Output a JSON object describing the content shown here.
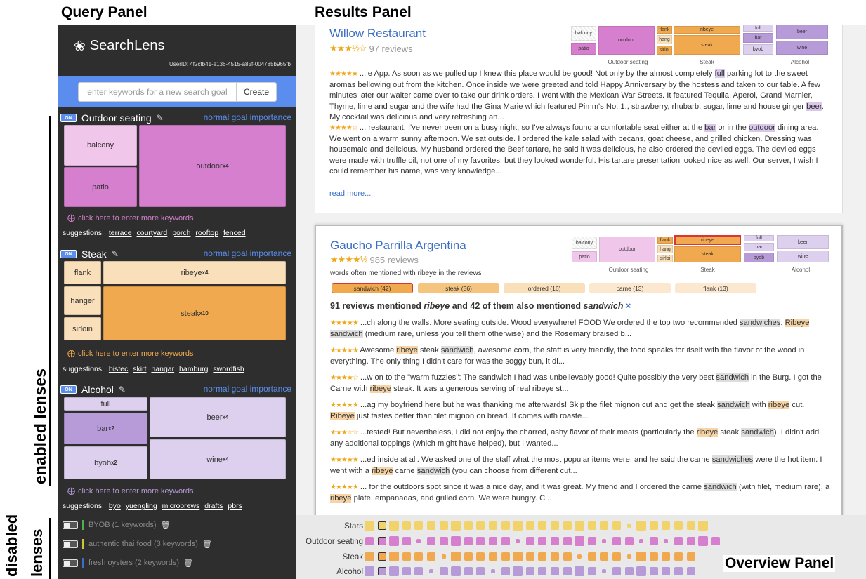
{
  "headings": {
    "query_panel": "Query Panel",
    "results_panel": "Results Panel",
    "overview_panel": "Overview Panel"
  },
  "side_labels": {
    "enabled": "enabled lenses",
    "disabled_line1": "disabled",
    "disabled_line2": "lenses"
  },
  "app": {
    "name": "SearchLens",
    "user_id": "UserID: 4f2cfb41-e136-4515-a85f-004785b965fb"
  },
  "goal": {
    "placeholder": "enter keywords for a new search goal",
    "create_label": "Create"
  },
  "colors": {
    "accent": "#5a8dee",
    "outdoor": "#d77fcf",
    "outdoor_light": "#f0c7ea",
    "steak": "#f0a94f",
    "steak_light": "#f9dfba",
    "alcohol": "#b79bd8",
    "alcohol_light": "#ddd0ee",
    "query_bg": "#2e2e2e"
  },
  "lenses": [
    {
      "toggle": "ON",
      "title": "Outdoor seating",
      "importance": "normal goal importance",
      "cells": [
        {
          "label": "balcony",
          "mult": ""
        },
        {
          "label": "patio",
          "mult": ""
        },
        {
          "label": "outdoor",
          "mult": "x4"
        }
      ],
      "more": "click here to enter more keywords",
      "suggestions_label": "suggestions:",
      "suggestions": [
        "terrace",
        "courtyard",
        "porch",
        "rooftop",
        "fenced"
      ]
    },
    {
      "toggle": "ON",
      "title": "Steak",
      "importance": "normal goal importance",
      "cells": [
        {
          "label": "flank",
          "mult": ""
        },
        {
          "label": "ribeye",
          "mult": "x4"
        },
        {
          "label": "hanger",
          "mult": ""
        },
        {
          "label": "sirloin",
          "mult": ""
        },
        {
          "label": "steak",
          "mult": "x10"
        }
      ],
      "more": "click here to enter more keywords",
      "suggestions_label": "suggestions:",
      "suggestions": [
        "bistec",
        "skirt",
        "hangar",
        "hamburg",
        "swordfish"
      ]
    },
    {
      "toggle": "ON",
      "title": "Alcohol",
      "importance": "normal goal importance",
      "cells": [
        {
          "label": "full",
          "mult": ""
        },
        {
          "label": "bar",
          "mult": "x2"
        },
        {
          "label": "byob",
          "mult": "x2"
        },
        {
          "label": "beer",
          "mult": "x4"
        },
        {
          "label": "wine",
          "mult": "x4"
        }
      ],
      "more": "click here to enter more keywords",
      "suggestions_label": "suggestions:",
      "suggestions": [
        "byo",
        "yuengling",
        "microbrews",
        "drafts",
        "pbrs"
      ]
    }
  ],
  "disabled_lenses": [
    {
      "label": "BYOB (1 keywords)",
      "color": "#4caf50"
    },
    {
      "label": "authentic thai food (3 keywords)",
      "color": "#c8c83c"
    },
    {
      "label": "fresh oysters (2 keywords)",
      "color": "#3a6fc4"
    }
  ],
  "mini_treemap": {
    "outdoor": [
      "balcony",
      "outdoor",
      "patio"
    ],
    "steak": [
      "flank",
      "ribeye",
      "hang",
      "sirloi",
      "steak"
    ],
    "alcohol": [
      "full",
      "beer",
      "bar",
      "byob",
      "wine"
    ],
    "labels": [
      "Outdoor seating",
      "Steak",
      "Alcohol"
    ]
  },
  "results": [
    {
      "name": "Willow Restaurant",
      "stars": "★★★½☆",
      "reviews": "97 reviews",
      "review_items": [
        {
          "stars": "★★★★★",
          "parts": [
            {
              "t": " ...le App. As soon as we pulled up I knew this place would be good! Not only by the almost completely "
            },
            {
              "t": "full",
              "h": "purple"
            },
            {
              "t": " parking lot to the sweet aromas bellowing out from the kitchen. Once inside we were greeted and told Happy Anniversary by the hostess and taken to our table. A few minutes later our waiter came over to take our drink orders. I went with the Mexican War Streets. It featured Tequila, Aperol, Grand Marnier, Thyme, lime and sugar and the wife had the Gina Marie which featured Pimm's No. 1., strawberry, rhubarb, sugar, lime and house ginger "
            },
            {
              "t": "beer",
              "h": "purple"
            },
            {
              "t": ". My cocktail was delicious and very refreshing an..."
            }
          ]
        },
        {
          "stars": "★★★★☆",
          "parts": [
            {
              "t": " ... restaurant. I've never been on a busy night, so I've always found a comfortable seat either at the "
            },
            {
              "t": "bar",
              "h": "purple"
            },
            {
              "t": " or in the "
            },
            {
              "t": "outdoor",
              "h": "purple"
            },
            {
              "t": " dining area. We went on a warm sunny afternoon. We sat outside. I ordered the kale salad with pecans, goat cheese, and grilled chicken. Dressing was housemaid and delicious. My husband ordered the Beef tartare, he said it was delicious, he also ordered the deviled eggs. The deviled eggs were made with truffle oil, not one of my favorites, but they looked wonderful. His tartare presentation looked nice as well. Our server, I wish I could remember his name, was very knowledge..."
            }
          ]
        }
      ],
      "read_more": "read more..."
    },
    {
      "name": "Gaucho Parrilla Argentina",
      "stars": "★★★★½",
      "reviews": "985 reviews",
      "often_label": "words often mentioned with ribeye in the reviews",
      "cooc": [
        "sandwich (42)",
        "steak (36)",
        "ordered (16)",
        "carne (13)",
        "flank (13)"
      ],
      "mentioned": {
        "prefix": "91 reviews mentioned ",
        "kw1": "ribeye",
        "middle": " and 42 of them also mentioned ",
        "kw2": "sandwich",
        "close": "×"
      },
      "review_items": [
        {
          "stars": "★★★★★",
          "parts": [
            {
              "t": " ...ch along the walls. More seating outside. Wood everywhere! FOOD We ordered the top two recommended "
            },
            {
              "t": "sandwiches",
              "h": "gray"
            },
            {
              "t": ": "
            },
            {
              "t": "Ribeye",
              "h": "orange"
            },
            {
              "t": " "
            },
            {
              "t": "sandwich",
              "h": "gray"
            },
            {
              "t": " (medium rare, unless you tell them otherwise) and the Rosemary braised b..."
            }
          ]
        },
        {
          "stars": "★★★★★",
          "parts": [
            {
              "t": " Awesome "
            },
            {
              "t": "ribeye",
              "h": "orange"
            },
            {
              "t": " steak "
            },
            {
              "t": "sandwich",
              "h": "gray"
            },
            {
              "t": ", awesome corn, the staff is very friendly, the food speaks for itself with the flavor of the wood in everything. The only thing I didn't care for was the soggy bun, it di..."
            }
          ]
        },
        {
          "stars": "★★★★☆",
          "parts": [
            {
              "t": " ...w on to the \"warm fuzzies\": The sandwich I had was unbelievably good! Quite possibly the very best "
            },
            {
              "t": "sandwich",
              "h": "gray"
            },
            {
              "t": " in the Burg. I got the Carne with "
            },
            {
              "t": "ribeye",
              "h": "orange"
            },
            {
              "t": " steak. It was a generous serving of real ribeye st..."
            }
          ]
        },
        {
          "stars": "★★★★★",
          "parts": [
            {
              "t": " ...ag my boyfriend here but he was thanking me afterwards! Skip the filet mignon cut and get the steak "
            },
            {
              "t": "sandwich",
              "h": "gray"
            },
            {
              "t": " with "
            },
            {
              "t": "ribeye",
              "h": "orange"
            },
            {
              "t": " cut. "
            },
            {
              "t": "Ribeye",
              "h": "orange"
            },
            {
              "t": " just tastes better than filet mignon on bread. It comes with roaste..."
            }
          ]
        },
        {
          "stars": "★★★☆☆",
          "parts": [
            {
              "t": " ...tested! But nevertheless, I did not enjoy the charred, ashy flavor of their meats (particularly the "
            },
            {
              "t": "ribeye",
              "h": "orange"
            },
            {
              "t": " steak "
            },
            {
              "t": "sandwich",
              "h": "gray"
            },
            {
              "t": "). I didn't add any additional toppings (which might have helped), but I wanted..."
            }
          ]
        },
        {
          "stars": "★★★★★",
          "parts": [
            {
              "t": " ...ed inside at all. We asked one of the staff what the most popular items were, and he said the carne "
            },
            {
              "t": "sandwiches",
              "h": "gray"
            },
            {
              "t": " were the hot item. I went with a "
            },
            {
              "t": "ribeye",
              "h": "orange"
            },
            {
              "t": " carne "
            },
            {
              "t": "sandwich",
              "h": "gray"
            },
            {
              "t": " (you can choose from different cut..."
            }
          ]
        },
        {
          "stars": "★★★★★",
          "parts": [
            {
              "t": " ... for the outdoors spot since it was a nice day, and it was great. My friend and I ordered the carne "
            },
            {
              "t": "sandwich",
              "h": "gray"
            },
            {
              "t": " (with filet, medium rare), a "
            },
            {
              "t": "ribeye",
              "h": "orange"
            },
            {
              "t": " plate, empanadas, and grilled corn. We were hungry. C..."
            }
          ]
        }
      ]
    }
  ],
  "overview": {
    "rows": [
      {
        "label": "Stars",
        "color": "#f2d36b"
      },
      {
        "label": "Outdoor seating",
        "color": "#d77fcf"
      },
      {
        "label": "Steak",
        "color": "#f0a94f"
      },
      {
        "label": "Alcohol",
        "color": "#b79bd8"
      }
    ]
  }
}
